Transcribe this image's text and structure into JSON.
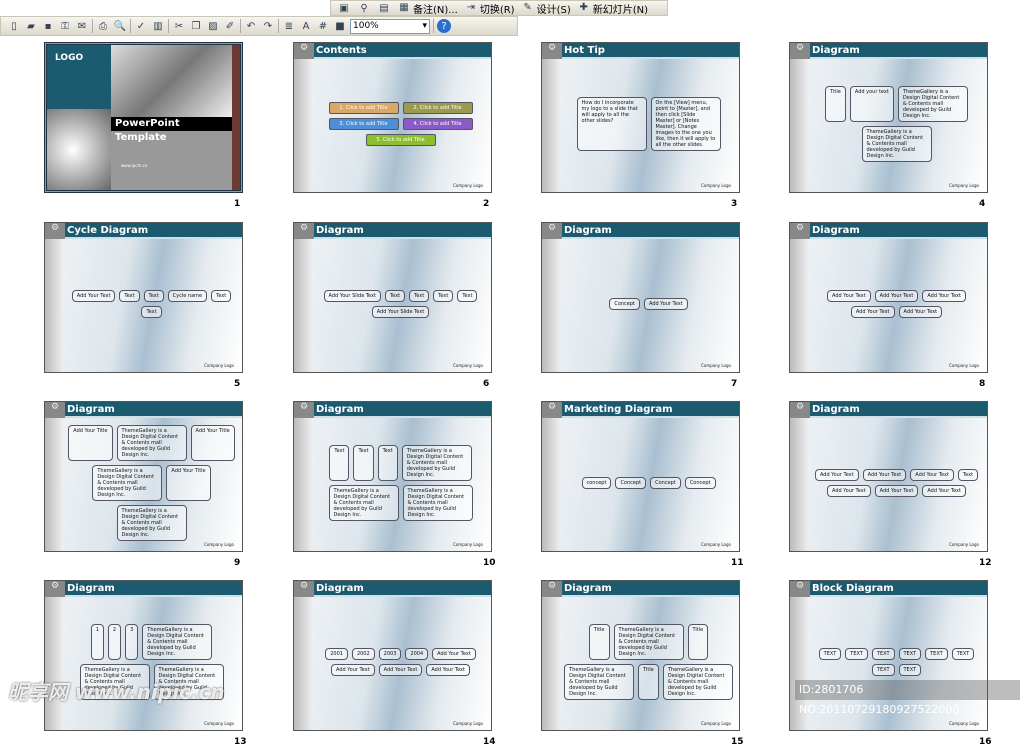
{
  "toolbar_top": {
    "items": [
      {
        "icon": "slide-layout-icon"
      },
      {
        "icon": "hyperlink-icon"
      },
      {
        "icon": "hide-slide-icon"
      },
      {
        "icon": "notes-icon",
        "label": "备注(N)..."
      },
      {
        "icon": "transition-icon",
        "label": "切换(R)"
      },
      {
        "icon": "design-icon",
        "label": "设计(S)"
      },
      {
        "icon": "new-slide-icon",
        "label": "新幻灯片(N)"
      }
    ]
  },
  "toolbar_std": {
    "icons": [
      "new-icon",
      "open-icon",
      "save-icon",
      "permission-icon",
      "email-icon",
      "print-icon",
      "print-preview-icon",
      "spelling-icon",
      "research-icon",
      "cut-icon",
      "copy-icon",
      "paste-icon",
      "format-painter-icon",
      "undo-icon",
      "redo-icon",
      "expand-icon",
      "show-formatting-icon",
      "grid-icon",
      "color-grayscale-icon"
    ],
    "zoom": "100%",
    "help": "help-icon"
  },
  "slides": [
    {
      "num": "1",
      "type": "title",
      "logo": "LOGO",
      "title": "PowerPoint Template",
      "url": "www.ipcm.cn"
    },
    {
      "num": "2",
      "title": "Contents",
      "items": [
        "1. Click to add Title",
        "2. Click to add Title",
        "3. Click to add Title",
        "4. Click to add Title",
        "5. Click to add Title"
      ],
      "colors": [
        "#d9a766",
        "#9b9a4e",
        "#4a8fd8",
        "#8a5ac8",
        "#8cbf2e"
      ]
    },
    {
      "num": "3",
      "title": "Hot Tip",
      "items": [
        "How do I incorporate my logo to a slide that will apply to all the other slides?",
        "On the [View] menu, point to [Master], and then click [Slide Master] or [Notes Master]. Change images to the one you like, then it will apply to all the other slides."
      ]
    },
    {
      "num": "4",
      "title": "Diagram",
      "items": [
        "Title",
        "Add your text",
        "ThemeGallery is a Design Digital Content & Contents mall developed by Guild Design Inc.",
        "ThemeGallery is a Design Digital Content & Contents mall developed by Guild Design Inc."
      ]
    },
    {
      "num": "5",
      "title": "Cycle Diagram",
      "items": [
        "Add Your Text",
        "Text",
        "Text",
        "Cycle name",
        "Text",
        "Text"
      ]
    },
    {
      "num": "6",
      "title": "Diagram",
      "items": [
        "Add Your Slide Text",
        "Text",
        "Text",
        "Text",
        "Text",
        "Add Your Slide Text"
      ]
    },
    {
      "num": "7",
      "title": "Diagram",
      "items": [
        "Concept",
        "Add Your Text"
      ]
    },
    {
      "num": "8",
      "title": "Diagram",
      "items": [
        "Add Your Text",
        "Add Your Text",
        "Add Your Text",
        "Add Your Text",
        "Add Your Text"
      ]
    },
    {
      "num": "9",
      "title": "Diagram",
      "items": [
        "Add Your Title",
        "ThemeGallery is a Design Digital Content & Contents mall developed by Guild Design Inc.",
        "Add Your Title",
        "ThemeGallery is a Design Digital Content & Contents mall developed by Guild Design Inc.",
        "Add Your Title",
        "ThemeGallery is a Design Digital Content & Contents mall developed by Guild Design Inc."
      ]
    },
    {
      "num": "10",
      "title": "Diagram",
      "items": [
        "Text",
        "Text",
        "Text",
        "ThemeGallery is a Design Digital Content & Contents mall developed by Guild Design Inc.",
        "ThemeGallery is a Design Digital Content & Contents mall developed by Guild Design Inc.",
        "ThemeGallery is a Design Digital Content & Contents mall developed by Guild Design Inc."
      ]
    },
    {
      "num": "11",
      "title": "Marketing Diagram",
      "items": [
        "concept",
        "Concept",
        "Concept",
        "Concept"
      ]
    },
    {
      "num": "12",
      "title": "Diagram",
      "items": [
        "Add Your Text",
        "Add Your Text",
        "Add Your Text",
        "Text",
        "Add Your Text",
        "Add Your Text",
        "Add Your Text"
      ]
    },
    {
      "num": "13",
      "title": "Diagram",
      "items": [
        "1",
        "2",
        "3",
        "ThemeGallery is a Design Digital Content & Contents mall developed by Guild Design Inc.",
        "ThemeGallery is a Design Digital Content & Contents mall developed by Guild Design Inc.",
        "ThemeGallery is a Design Digital Content & Contents mall developed by Guild Design Inc."
      ]
    },
    {
      "num": "14",
      "title": "Diagram",
      "items": [
        "2001",
        "2002",
        "2003",
        "2004",
        "Add Your Text",
        "Add Your Text",
        "Add Your Text",
        "Add Your Text"
      ]
    },
    {
      "num": "15",
      "title": "Diagram",
      "items": [
        "Title",
        "ThemeGallery is a Design Digital Content & Contents mall developed by Guild Design Inc.",
        "Title",
        "ThemeGallery is a Design Digital Content & Contents mall developed by Guild Design Inc.",
        "Title",
        "ThemeGallery is a Design Digital Content & Contents mall developed by Guild Design Inc."
      ]
    },
    {
      "num": "16",
      "title": "Block Diagram",
      "items": [
        "TEXT",
        "TEXT",
        "TEXT",
        "TEXT",
        "TEXT",
        "TEXT",
        "TEXT",
        "TEXT"
      ]
    }
  ],
  "footer": "Company Logo",
  "watermark_left": "昵享网 www.nipic.cn",
  "watermark_right": "ID:2801706 NO:20110729180927522000"
}
